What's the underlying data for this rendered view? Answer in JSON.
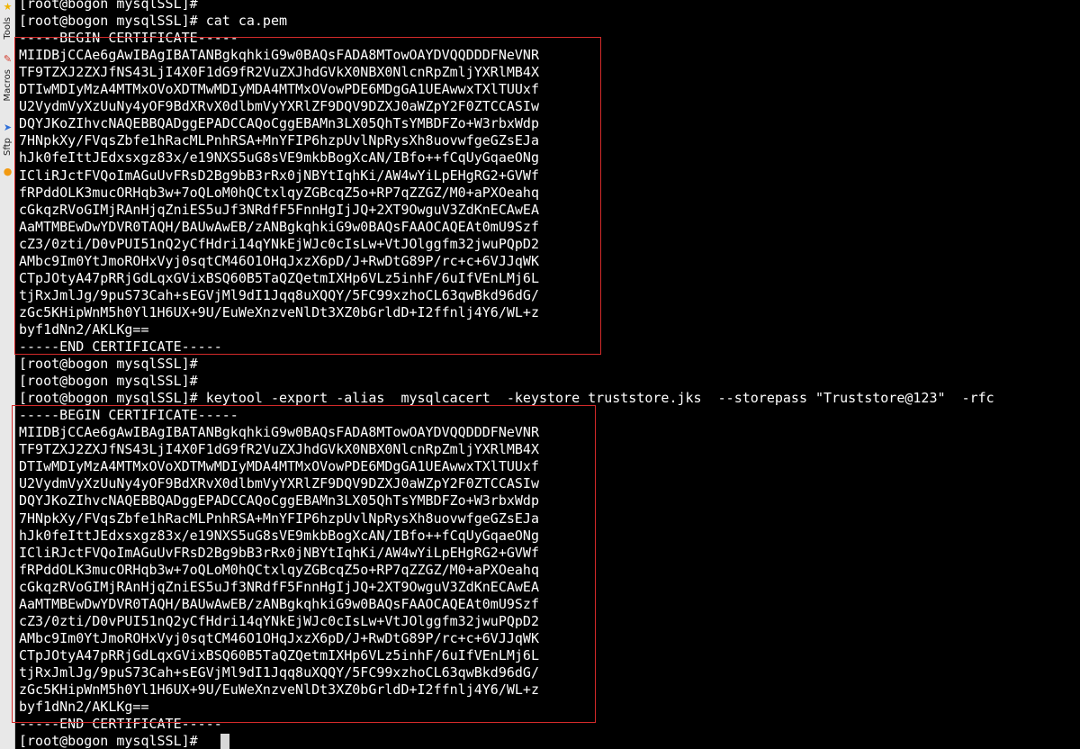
{
  "side_toolbar": {
    "tabs": [
      {
        "label": "Tools",
        "icon": "star-icon"
      },
      {
        "label": "Macros",
        "icon": "wrench-icon"
      },
      {
        "label": "Sftp",
        "icon": "paper-plane-icon"
      }
    ]
  },
  "terminal": {
    "colors": {
      "background": "#000000",
      "foreground": "#ffffff",
      "highlight_border": "#d42a2a",
      "cursor": "#d8d8d8"
    },
    "lines": [
      "[root@bogon mysqlSSL]#",
      "[root@bogon mysqlSSL]# cat ca.pem",
      "-----BEGIN CERTIFICATE-----",
      "MIIDBjCCAe6gAwIBAgIBATANBgkqhkiG9w0BAQsFADA8MTowOAYDVQQDDDFNeVNR",
      "TF9TZXJ2ZXJfNS43LjI4X0F1dG9fR2VuZXJhdGVkX0NBX0NlcnRpZmljYXRlMB4X",
      "DTIwMDIyMzA4MTMxOVoXDTMwMDIyMDA4MTMxOVowPDE6MDgGA1UEAwwxTXlTUUxf",
      "U2VydmVyXzUuNy4yOF9BdXRvX0dlbmVyYXRlZF9DQV9DZXJ0aWZpY2F0ZTCCASIw",
      "DQYJKoZIhvcNAQEBBQADggEPADCCAQoCggEBAMn3LX05QhTsYMBDFZo+W3rbxWdp",
      "7HNpkXy/FVqsZbfe1hRacMLPnhRSA+MnYFIP6hzpUvlNpRysXh8uovwfgeGZsEJa",
      "hJk0feIttJEdxsxgz83x/e19NXS5uG8sVE9mkbBogXcAN/IBfo++fCqUyGqaeONg",
      "ICliRJctFVQoImAGuUvFRsD2Bg9bB3rRx0jNBYtIqhKi/AW4wYiLpEHgRG2+GVWf",
      "fRPddOLK3mucORHqb3w+7oQLoM0hQCtxlqyZGBcqZ5o+RP7qZZGZ/M0+aPXOeahq",
      "cGkqzRVoGIMjRAnHjqZniES5uJf3NRdfF5FnnHgIjJQ+2XT9OwguV3ZdKnECAwEA",
      "AaMTMBEwDwYDVR0TAQH/BAUwAwEB/zANBgkqhkiG9w0BAQsFAAOCAQEAt0mU9Szf",
      "cZ3/0zti/D0vPUI51nQ2yCfHdri14qYNkEjWJc0cIsLw+VtJOlggfm32jwuPQpD2",
      "AMbc9Im0YtJmoROHxVyj0sqtCM46O1OHqJxzX6pD/J+RwDtG89P/rc+c+6VJJqWK",
      "CTpJOtyA47pRRjGdLqxGVixBSQ60B5TaQZQetmIXHp6VLz5inhF/6uIfVEnLMj6L",
      "tjRxJmlJg/9puS73Cah+sEGVjMl9dI1Jqq8uXQQY/5FC99xzhoCL63qwBkd96dG/",
      "zGc5KHipWnM5h0Yl1H6UX+9U/EuWeXnzveNlDt3XZ0bGrldD+I2ffnlj4Y6/WL+z",
      "byf1dNn2/AKLKg==",
      "-----END CERTIFICATE-----",
      "[root@bogon mysqlSSL]#",
      "[root@bogon mysqlSSL]#",
      "[root@bogon mysqlSSL]# keytool -export -alias  mysqlcacert  -keystore truststore.jks  --storepass \"Truststore@123\"  -rfc",
      "-----BEGIN CERTIFICATE-----",
      "MIIDBjCCAe6gAwIBAgIBATANBgkqhkiG9w0BAQsFADA8MTowOAYDVQQDDDFNeVNR",
      "TF9TZXJ2ZXJfNS43LjI4X0F1dG9fR2VuZXJhdGVkX0NBX0NlcnRpZmljYXRlMB4X",
      "DTIwMDIyMzA4MTMxOVoXDTMwMDIyMDA4MTMxOVowPDE6MDgGA1UEAwwxTXlTUUxf",
      "U2VydmVyXzUuNy4yOF9BdXRvX0dlbmVyYXRlZF9DQV9DZXJ0aWZpY2F0ZTCCASIw",
      "DQYJKoZIhvcNAQEBBQADggEPADCCAQoCggEBAMn3LX05QhTsYMBDFZo+W3rbxWdp",
      "7HNpkXy/FVqsZbfe1hRacMLPnhRSA+MnYFIP6hzpUvlNpRysXh8uovwfgeGZsEJa",
      "hJk0feIttJEdxsxgz83x/e19NXS5uG8sVE9mkbBogXcAN/IBfo++fCqUyGqaeONg",
      "ICliRJctFVQoImAGuUvFRsD2Bg9bB3rRx0jNBYtIqhKi/AW4wYiLpEHgRG2+GVWf",
      "fRPddOLK3mucORHqb3w+7oQLoM0hQCtxlqyZGBcqZ5o+RP7qZZGZ/M0+aPXOeahq",
      "cGkqzRVoGIMjRAnHjqZniES5uJf3NRdfF5FnnHgIjJQ+2XT9OwguV3ZdKnECAwEA",
      "AaMTMBEwDwYDVR0TAQH/BAUwAwEB/zANBgkqhkiG9w0BAQsFAAOCAQEAt0mU9Szf",
      "cZ3/0zti/D0vPUI51nQ2yCfHdri14qYNkEjWJc0cIsLw+VtJOlggfm32jwuPQpD2",
      "AMbc9Im0YtJmoROHxVyj0sqtCM46O1OHqJxzX6pD/J+RwDtG89P/rc+c+6VJJqWK",
      "CTpJOtyA47pRRjGdLqxGVixBSQ60B5TaQZQetmIXHp6VLz5inhF/6uIfVEnLMj6L",
      "tjRxJmlJg/9puS73Cah+sEGVjMl9dI1Jqq8uXQQY/5FC99xzhoCL63qwBkd96dG/",
      "zGc5KHipWnM5h0Yl1H6UX+9U/EuWeXnzveNlDt3XZ0bGrldD+I2ffnlj4Y6/WL+z",
      "byf1dNn2/AKLKg==",
      "-----END CERTIFICATE-----",
      "[root@bogon mysqlSSL]# "
    ]
  }
}
